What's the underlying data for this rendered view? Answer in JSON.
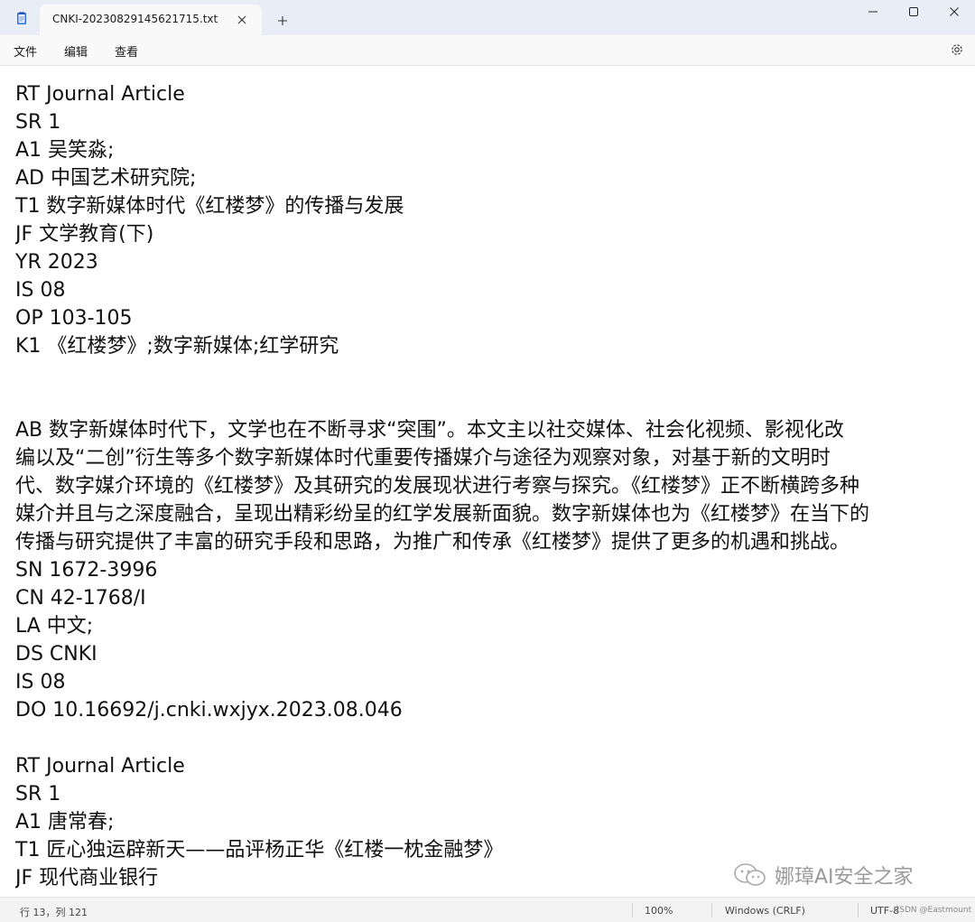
{
  "window": {
    "tab_title": "CNKI-20230829145621715.txt",
    "new_tab_symbol": "+",
    "close_symbol": "✕",
    "minimize_icon": "minimize-icon",
    "maximize_icon": "maximize-icon",
    "close_icon": "close-icon",
    "app_icon": "notepad-icon"
  },
  "menu": {
    "file": "文件",
    "edit": "编辑",
    "view": "查看",
    "settings_icon": "gear-icon"
  },
  "editor": {
    "lines": [
      "RT Journal Article",
      "SR 1",
      "A1 吴笑淼;",
      "AD 中国艺术研究院;",
      "T1 数字新媒体时代《红楼梦》的传播与发展",
      "JF 文学教育(下)",
      "YR 2023",
      "IS 08",
      "OP 103-105",
      "K1 《红楼梦》;数字新媒体;红学研究",
      "",
      "",
      "AB 数字新媒体时代下，文学也在不断寻求“突围”。本文主以社交媒体、社会化视频、影视化改",
      "编以及“二创”衍生等多个数字新媒体时代重要传播媒介与途径为观察对象，对基于新的文明时",
      "代、数字媒介环境的《红楼梦》及其研究的发展现状进行考察与探究。《红楼梦》正不断横跨多种",
      "媒介并且与之深度融合，呈现出精彩纷呈的红学发展新面貌。数字新媒体也为《红楼梦》在当下的",
      "传播与研究提供了丰富的研究手段和思路，为推广和传承《红楼梦》提供了更多的机遇和挑战。",
      "SN 1672-3996",
      "CN 42-1768/I",
      "LA 中文;",
      "DS CNKI",
      "IS 08",
      "DO 10.16692/j.cnki.wxjyx.2023.08.046",
      "",
      "RT Journal Article",
      "SR 1",
      "A1 唐常春;",
      "T1 匠心独运辟新天——品评杨正华《红楼一枕金融梦》",
      "JF 现代商业银行"
    ]
  },
  "watermark": {
    "text": "娜璋AI安全之家",
    "logo_icon": "wechat-logo-icon"
  },
  "status": {
    "position": "行 13，列 121",
    "zoom": "100%",
    "line_ending": "Windows (CRLF)",
    "encoding": "UTF-8",
    "credit": "CSDN @Eastmount"
  }
}
